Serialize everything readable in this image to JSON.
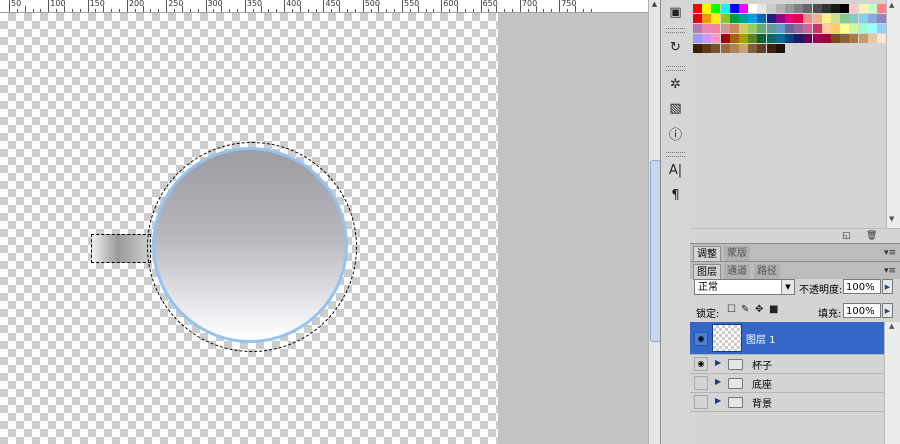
{
  "ruler": {
    "labels": [
      "50",
      "100",
      "150",
      "200",
      "250",
      "300",
      "350",
      "400",
      "450",
      "500",
      "550",
      "600",
      "650",
      "700",
      "750"
    ]
  },
  "canvas": {
    "layer_shapes": [
      "cup-handle",
      "cup-body"
    ]
  },
  "tools": {
    "icons": [
      "navigator-icon",
      "history-icon",
      "actions-icon",
      "histogram-icon",
      "info-icon",
      "character-icon",
      "paragraph-icon"
    ]
  },
  "swatches": {
    "colors": [
      "#ff0000",
      "#ffff00",
      "#00ff00",
      "#00ffff",
      "#0000ff",
      "#ff00ff",
      "#ffffff",
      "#e6e6e6",
      "#cccccc",
      "#b3b3b3",
      "#999999",
      "#808080",
      "#666666",
      "#4d4d4d",
      "#333333",
      "#1a1a1a",
      "#000000",
      "#ffc8c8",
      "#fff0b4",
      "#c8ffc8",
      "#ff8080",
      "#e60012",
      "#f39800",
      "#fff100",
      "#8fc31f",
      "#009944",
      "#009e96",
      "#00a0e9",
      "#0068b7",
      "#1d2088",
      "#920783",
      "#e4007f",
      "#e5004f",
      "#ee8a8a",
      "#f5b382",
      "#fff58c",
      "#cbe293",
      "#86c891",
      "#87c8c1",
      "#86cff1",
      "#8aaad7",
      "#8e86c1",
      "#b87ab4",
      "#ef87b5",
      "#f0879f",
      "#cc9999",
      "#cc8855",
      "#cccc66",
      "#99cc66",
      "#66aa77",
      "#669999",
      "#6699cc",
      "#666699",
      "#996699",
      "#cc6699",
      "#cc3366",
      "#ffcc99",
      "#ffcc66",
      "#ffff99",
      "#ccff99",
      "#99ffcc",
      "#99ffff",
      "#99ccff",
      "#9999ff",
      "#cc99ff",
      "#ff99cc",
      "#a40000",
      "#a8620a",
      "#a3a100",
      "#5a8323",
      "#006633",
      "#006b65",
      "#006c9b",
      "#00427a",
      "#1a1a66",
      "#650058",
      "#a1005a",
      "#a0003a",
      "#7d4a1e",
      "#8c6239",
      "#aa7a3a",
      "#c59c6d",
      "#e2c8a4",
      "#f6e7d2",
      "#3a1f00",
      "#5a3a1a",
      "#7a5230",
      "#9a6a42",
      "#b08458",
      "#c8a274",
      "#806040",
      "#604020",
      "#402010",
      "#201008"
    ]
  },
  "swatch_panel": {
    "bottom_icons": [
      "new-swatch-icon",
      "trash-icon"
    ]
  },
  "adjust_tabs": {
    "tab1": "调整",
    "tab2": "蒙版"
  },
  "layers_tabs": {
    "tab1": "图层",
    "tab2": "通道",
    "tab3": "路径"
  },
  "layers_options": {
    "blend_mode": "正常",
    "opacity_label": "不透明度:",
    "opacity_value": "100%",
    "lock_label": "锁定:",
    "fill_label": "填充:",
    "fill_value": "100%"
  },
  "layers": {
    "active": {
      "name": "图层 1",
      "visible": true
    },
    "groups": [
      {
        "name": "杯子",
        "visible": true
      },
      {
        "name": "底座",
        "visible": false
      },
      {
        "name": "背景",
        "visible": false
      }
    ]
  }
}
